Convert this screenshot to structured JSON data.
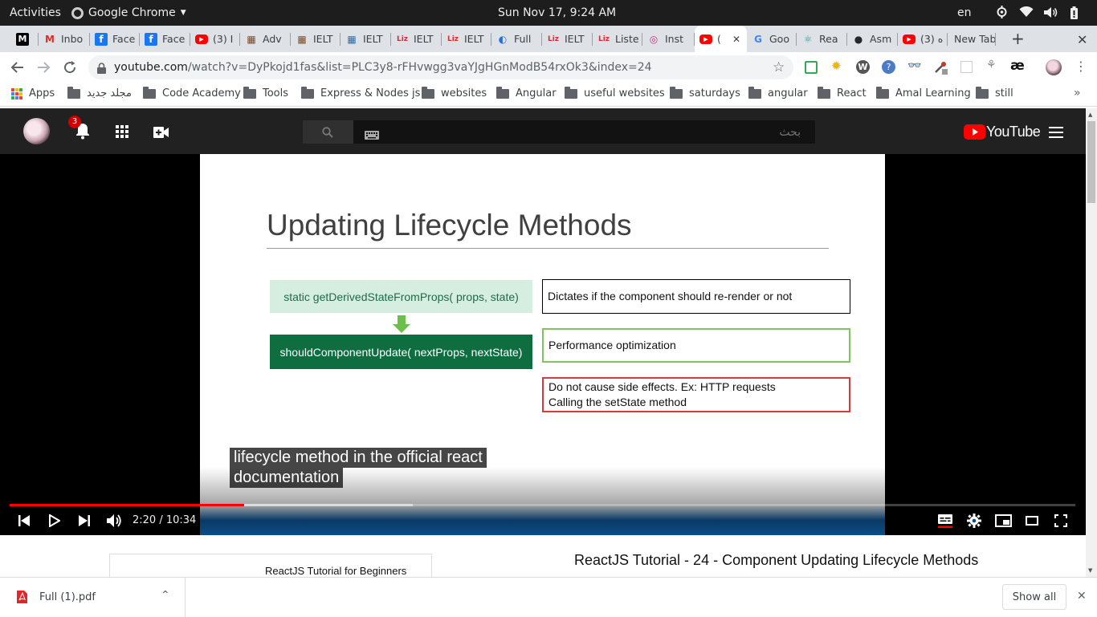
{
  "system_bar": {
    "activities": "Activities",
    "app_name": "Google Chrome",
    "clock": "Sun Nov 17,  9:24 AM",
    "language": "en",
    "icons": [
      "accessibility-icon",
      "wifi-icon",
      "volume-icon",
      "battery-icon"
    ]
  },
  "tabs": [
    {
      "label": "",
      "favicon": "M",
      "color": "#000000"
    },
    {
      "label": "Inbo",
      "favicon": "M",
      "color": "#d93025"
    },
    {
      "label": "Face",
      "favicon": "f",
      "color": "#1877f2"
    },
    {
      "label": "Face",
      "favicon": "f",
      "color": "#1877f2"
    },
    {
      "label": "(3) I",
      "favicon": "▶",
      "color": "#ff0000"
    },
    {
      "label": "Adv",
      "favicon": "▦",
      "color": "#7a4a2a"
    },
    {
      "label": "IELT",
      "favicon": "▦",
      "color": "#7a4a2a"
    },
    {
      "label": "IELT",
      "favicon": "▦",
      "color": "#2a6ea0"
    },
    {
      "label": "IELT",
      "favicon": "Liz",
      "color": "#d32f2f"
    },
    {
      "label": "IELT",
      "favicon": "Liz",
      "color": "#d32f2f"
    },
    {
      "label": "Full",
      "favicon": "◐",
      "color": "#1a73e8"
    },
    {
      "label": "IELT",
      "favicon": "Liz",
      "color": "#d32f2f"
    },
    {
      "label": "Liste",
      "favicon": "Liz",
      "color": "#d32f2f"
    },
    {
      "label": "Inst",
      "favicon": "◎",
      "color": "#c13584"
    },
    {
      "label": "(",
      "favicon": "▶",
      "color": "#ff0000",
      "active": true
    },
    {
      "label": "Goo",
      "favicon": "G",
      "color": "#4285f4"
    },
    {
      "label": "Rea",
      "favicon": "⚛",
      "color": "#2aa198"
    },
    {
      "label": "Asm",
      "favicon": "●",
      "color": "#24292e"
    },
    {
      "label": "(3) ه",
      "favicon": "▶",
      "color": "#ff0000"
    },
    {
      "label": "New Tab",
      "favicon": "",
      "color": ""
    }
  ],
  "toolbar": {
    "url_host": "youtube.com",
    "url_path": "/watch?v=DyPkojd1fas&list=PLC3y8-rFHvwgg3vaYJgHGnModB54rxOk3&index=24"
  },
  "bookmarks": [
    {
      "label": "Apps",
      "type": "apps"
    },
    {
      "label": "مجلد جديد",
      "type": "folder"
    },
    {
      "label": "Code Academy",
      "type": "folder"
    },
    {
      "label": "Tools",
      "type": "folder"
    },
    {
      "label": "Express & Nodes js",
      "type": "folder"
    },
    {
      "label": "websites",
      "type": "folder"
    },
    {
      "label": "Angular",
      "type": "folder"
    },
    {
      "label": "useful websites",
      "type": "folder"
    },
    {
      "label": "saturdays",
      "type": "folder"
    },
    {
      "label": "angular",
      "type": "folder"
    },
    {
      "label": "React",
      "type": "folder"
    },
    {
      "label": "Amal Learning",
      "type": "folder"
    },
    {
      "label": "still",
      "type": "folder"
    }
  ],
  "youtube": {
    "notification_count": "3",
    "search_placeholder": "بحث",
    "logo_text": "YouTube"
  },
  "slide": {
    "title": "Updating Lifecycle Methods",
    "left_boxes": [
      {
        "text": "static getDerivedStateFromProps( props, state)",
        "bg": "#d6eee0",
        "fg": "#1f6b45"
      },
      {
        "text": "shouldComponentUpdate( nextProps, nextState)",
        "bg": "#0e6e3f",
        "fg": "#ffffff"
      }
    ],
    "arrow_color": "#6dbf4b",
    "right_boxes": [
      {
        "lines": [
          "Dictates if the component should re-render or not"
        ],
        "border": "#000000"
      },
      {
        "lines": [
          "Performance optimization"
        ],
        "border": "#7ec560"
      },
      {
        "lines": [
          "Do not cause side effects. Ex: HTTP requests",
          "Calling the setState method"
        ],
        "border": "#d9393c"
      }
    ]
  },
  "captions": [
    "lifecycle method in the official react",
    "documentation"
  ],
  "player": {
    "time": "2:20 / 10:34",
    "played_fraction": 0.22,
    "loaded_fraction": 0.378
  },
  "below_video": {
    "playlist_title": "ReactJS Tutorial for Beginners",
    "video_title": "ReactJS Tutorial - 24 - Component Updating Lifecycle Methods"
  },
  "downloads": {
    "file_name": "Full (1).pdf",
    "show_all": "Show all"
  }
}
